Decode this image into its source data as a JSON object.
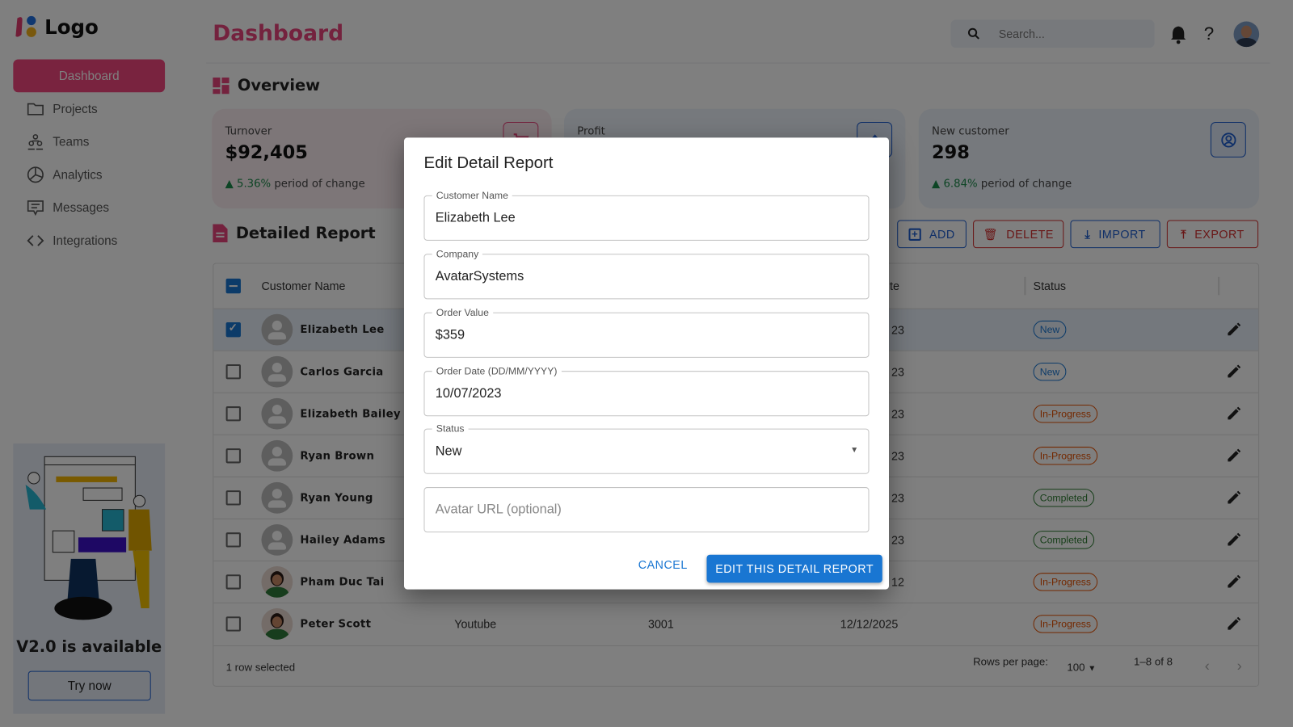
{
  "brand": {
    "logo_text": "Logo",
    "accent": "#f2477f"
  },
  "sidebar": {
    "items": [
      {
        "label": "Dashboard",
        "icon": "dashboard",
        "active": true
      },
      {
        "label": "Projects",
        "icon": "folder-icon"
      },
      {
        "label": "Teams",
        "icon": "teams-icon"
      },
      {
        "label": "Analytics",
        "icon": "pie-chart-icon"
      },
      {
        "label": "Messages",
        "icon": "message-icon"
      },
      {
        "label": "Integrations",
        "icon": "code-icon"
      }
    ],
    "promo": {
      "title": "V2.0 is available",
      "button": "Try now"
    }
  },
  "header": {
    "title": "Dashboard",
    "search_placeholder": "Search..."
  },
  "overview": {
    "heading": "Overview",
    "cards": [
      {
        "label": "Turnover",
        "value": "$92,405",
        "change": "5.36%",
        "change_text": "period of change",
        "icon": "cart-icon"
      },
      {
        "label": "Profit",
        "icon": "upload-icon"
      },
      {
        "label": "New customer",
        "value": "298",
        "change": "6.84%",
        "change_text": "period of change",
        "icon": "user-circle-icon"
      }
    ]
  },
  "report": {
    "heading": "Detailed Report",
    "actions": {
      "add": "ADD",
      "delete": "DELETE",
      "import": "IMPORT",
      "export": "EXPORT"
    },
    "columns": {
      "name": "Customer Name",
      "date_partial": "te",
      "status": "Status"
    },
    "rows": [
      {
        "name": "Elizabeth Lee",
        "date": "23",
        "status": "New",
        "selected": true
      },
      {
        "name": "Carlos Garcia",
        "date": "23",
        "status": "New"
      },
      {
        "name": "Elizabeth Bailey",
        "date": "23",
        "status": "In-Progress"
      },
      {
        "name": "Ryan Brown",
        "date": "23",
        "status": "In-Progress"
      },
      {
        "name": "Ryan Young",
        "date": "23",
        "status": "Completed"
      },
      {
        "name": "Hailey Adams",
        "date": "23",
        "status": "Completed"
      },
      {
        "name": "Pham Duc Tai",
        "date": "12",
        "status": "In-Progress",
        "photo": true
      },
      {
        "name": "Peter Scott",
        "company": "Youtube",
        "value": "3001",
        "date": "12/12/2025",
        "status": "In-Progress",
        "photo": true
      }
    ],
    "footer": {
      "selected": "1 row selected",
      "rows_per_page_label": "Rows per page:",
      "rows_per_page": "100",
      "range": "1–8 of 8"
    },
    "status_colors": {
      "New": "#1976d2",
      "In-Progress": "#e65100",
      "Completed": "#2e7d32"
    }
  },
  "modal": {
    "title": "Edit Detail Report",
    "fields": [
      {
        "label": "Customer Name",
        "value": "Elizabeth Lee"
      },
      {
        "label": "Company",
        "value": "AvatarSystems"
      },
      {
        "label": "Order Value",
        "value": "$359"
      },
      {
        "label": "Order Date (DD/MM/YYYY)",
        "value": "10/07/2023"
      },
      {
        "label": "Status",
        "value": "New"
      },
      {
        "placeholder": "Avatar URL (optional)"
      }
    ],
    "cancel": "CANCEL",
    "submit": "EDIT THIS DETAIL REPORT"
  }
}
